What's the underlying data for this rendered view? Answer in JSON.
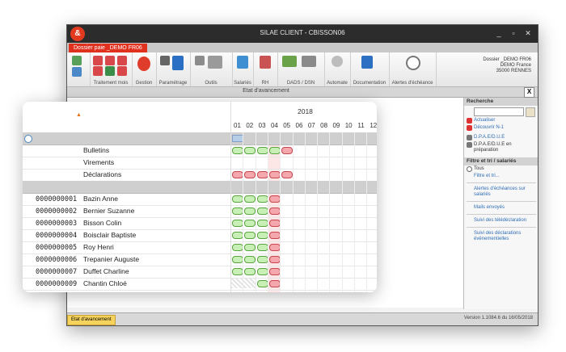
{
  "window": {
    "title": "SILAE CLIENT - CBISSON06",
    "tab": "Dossier paie _DEMO FR06",
    "minimize": "_",
    "maximize": "▫",
    "close": "✕"
  },
  "ribbon": {
    "groups": [
      "Traitement mois",
      "Gestion",
      "Paramétrage",
      "Outils",
      "Salariés",
      "RH",
      "DADS / DSN",
      "Automate",
      "Documentation",
      "Alertes d'échéance"
    ],
    "firm": [
      "Dossier _DEMO FR06",
      "DEMO France",
      "35000 RENNES"
    ]
  },
  "panel": {
    "title": "Etat d'avancement",
    "close": "X"
  },
  "sidebar": {
    "search_header": "Recherche",
    "actions": [
      "Actualiser",
      "Découvrir N-1",
      "D.P.A.E/D.U.E",
      "D.P.A.E/D.U.E en préparation"
    ],
    "filter_header": "Filtre et tri / salariés",
    "filters": [
      "Tous",
      "Filtre et tri..."
    ],
    "links": [
      "Alertes d'échéances sur salariés",
      "Mails envoyés",
      "Suivi des télédéclaration",
      "Suivi des déclarations événementielles"
    ]
  },
  "statusbar": {
    "tab": "Etat d'avancement",
    "version": "Version 1.1084.6 du 16/05/2018"
  },
  "grid": {
    "year": "2018",
    "sort_icon": "▲",
    "months": [
      "01",
      "02",
      "03",
      "04",
      "05",
      "06",
      "07",
      "08",
      "09",
      "10",
      "11",
      "12"
    ],
    "status_rows": [
      {
        "label": "Bulletins",
        "cells": [
          "ok",
          "ok",
          "ok",
          "ok",
          "ko"
        ]
      },
      {
        "label": "Virements",
        "cells": []
      },
      {
        "label": "Déclarations",
        "cells": [
          "ko",
          "ko",
          "ko",
          "ko",
          "ko"
        ]
      }
    ],
    "employees": [
      {
        "code": "0000000001",
        "name": "Bazin Anne",
        "cells": [
          "ok",
          "ok",
          "ok",
          "ko"
        ]
      },
      {
        "code": "0000000002",
        "name": "Bernier Suzanne",
        "cells": [
          "ok",
          "ok",
          "ok",
          "ko"
        ]
      },
      {
        "code": "0000000003",
        "name": "Bisson Colin",
        "cells": [
          "ok",
          "ok",
          "ok",
          "ko"
        ]
      },
      {
        "code": "0000000004",
        "name": "Boisclair Baptiste",
        "cells": [
          "ok",
          "ok",
          "ok",
          "ko"
        ]
      },
      {
        "code": "0000000005",
        "name": "Roy Henri",
        "cells": [
          "ok",
          "ok",
          "ok",
          "ko"
        ]
      },
      {
        "code": "0000000006",
        "name": "Trepanier Auguste",
        "cells": [
          "ok",
          "ok",
          "ok",
          "ko"
        ]
      },
      {
        "code": "0000000007",
        "name": "Duffet Charline",
        "cells": [
          "ok",
          "ok",
          "ok",
          "ko"
        ]
      },
      {
        "code": "0000000009",
        "name": "Chantin Chloé",
        "cells": [
          "",
          "",
          "ok",
          "ko"
        ]
      }
    ]
  }
}
